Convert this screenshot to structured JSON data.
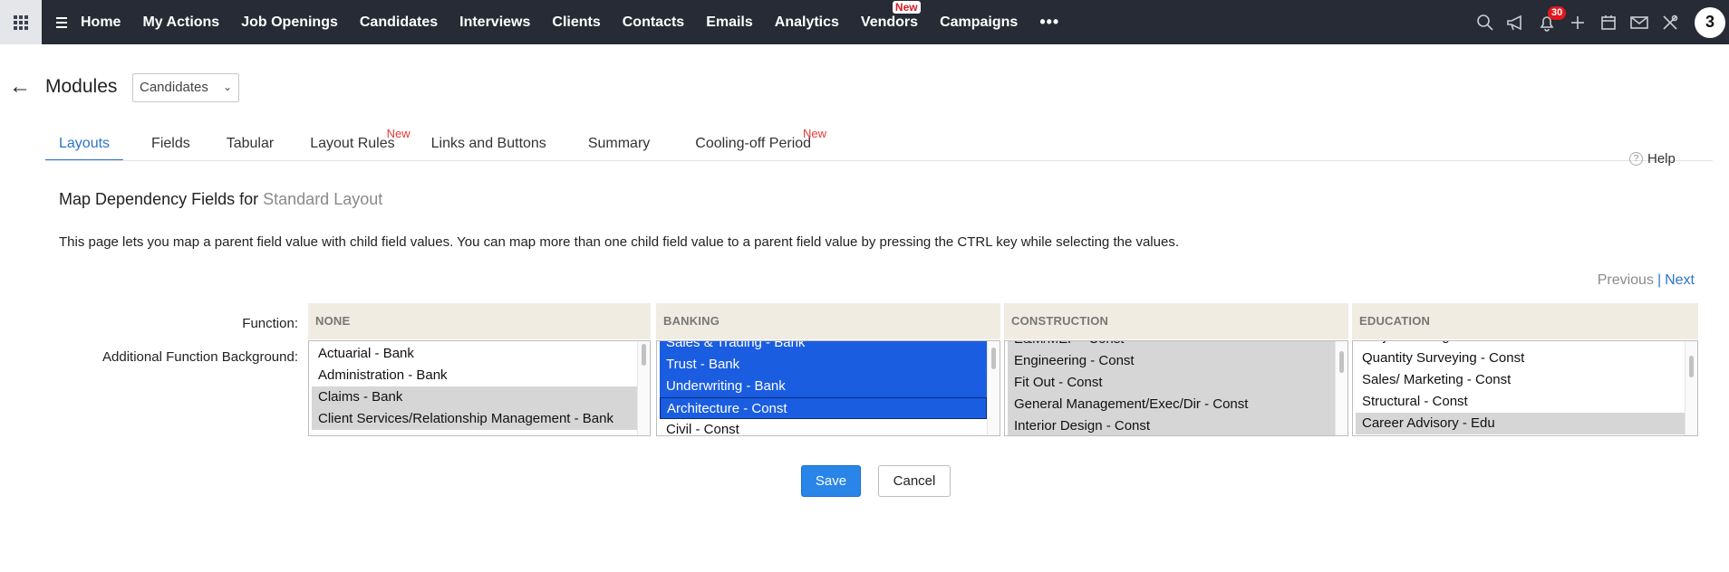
{
  "topnav": {
    "items": [
      {
        "label": "Home"
      },
      {
        "label": "My Actions"
      },
      {
        "label": "Job Openings"
      },
      {
        "label": "Candidates"
      },
      {
        "label": "Interviews"
      },
      {
        "label": "Clients"
      },
      {
        "label": "Contacts"
      },
      {
        "label": "Emails"
      },
      {
        "label": "Analytics"
      },
      {
        "label": "Vendors",
        "tag": "New"
      },
      {
        "label": "Campaigns"
      }
    ],
    "more_label": "•••",
    "notifications_count": "30",
    "avatar_text": "3"
  },
  "header": {
    "title": "Modules",
    "module_select": "Candidates"
  },
  "tabs": [
    {
      "label": "Layouts",
      "active": true
    },
    {
      "label": "Fields"
    },
    {
      "label": "Tabular"
    },
    {
      "label": "Layout Rules",
      "tag": "New"
    },
    {
      "label": "Links and Buttons"
    },
    {
      "label": "Summary"
    },
    {
      "label": "Cooling-off Period",
      "tag": "New"
    }
  ],
  "help_label": "Help",
  "content": {
    "title_prefix": "Map Dependency Fields for",
    "layout_name": "Standard Layout",
    "description": "This page lets you map a parent field value with child field values. You can map more than one child field value to a parent field value by pressing the CTRL key while selecting the values.",
    "previous_label": "Previous",
    "separator": "|",
    "next_label": "Next",
    "function_label": "Function:",
    "additional_label": "Additional Function Background:"
  },
  "columns": [
    {
      "header": "NONE",
      "offset": 0,
      "scroll_pos": 0.0,
      "options": [
        {
          "label": "Actuarial - Bank",
          "state": "normal"
        },
        {
          "label": "Administration - Bank",
          "state": "normal"
        },
        {
          "label": "Claims - Bank",
          "state": "gray"
        },
        {
          "label": "Client Services/Relationship Management - Bank",
          "state": "gray"
        }
      ]
    },
    {
      "header": "BANKING",
      "offset": 12,
      "scroll_pos": 0.05,
      "options": [
        {
          "label": "Sales & Trading - Bank",
          "state": "sel"
        },
        {
          "label": "Trust - Bank",
          "state": "sel"
        },
        {
          "label": "Underwriting - Bank",
          "state": "sel"
        },
        {
          "label": "Architecture - Const",
          "state": "sel-focus"
        },
        {
          "label": "Civil - Const",
          "state": "normal"
        }
      ]
    },
    {
      "header": "CONSTRUCTION",
      "offset": 16,
      "scroll_pos": 0.12,
      "options": [
        {
          "label": "E&M/MEP - Const",
          "state": "gray"
        },
        {
          "label": "Engineering - Const",
          "state": "gray"
        },
        {
          "label": "Fit Out - Const",
          "state": "gray"
        },
        {
          "label": "General Management/Exec/Dir - Const",
          "state": "gray"
        },
        {
          "label": "Interior Design - Const",
          "state": "gray"
        }
      ]
    },
    {
      "header": "EDUCATION",
      "offset": 19,
      "scroll_pos": 0.18,
      "options": [
        {
          "label": "Project Management - Const",
          "state": "normal"
        },
        {
          "label": "Quantity Surveying - Const",
          "state": "normal"
        },
        {
          "label": "Sales/ Marketing - Const",
          "state": "normal"
        },
        {
          "label": "Structural - Const",
          "state": "normal"
        },
        {
          "label": "Career Advisory - Edu",
          "state": "gray"
        }
      ]
    }
  ],
  "buttons": {
    "save": "Save",
    "cancel": "Cancel"
  }
}
